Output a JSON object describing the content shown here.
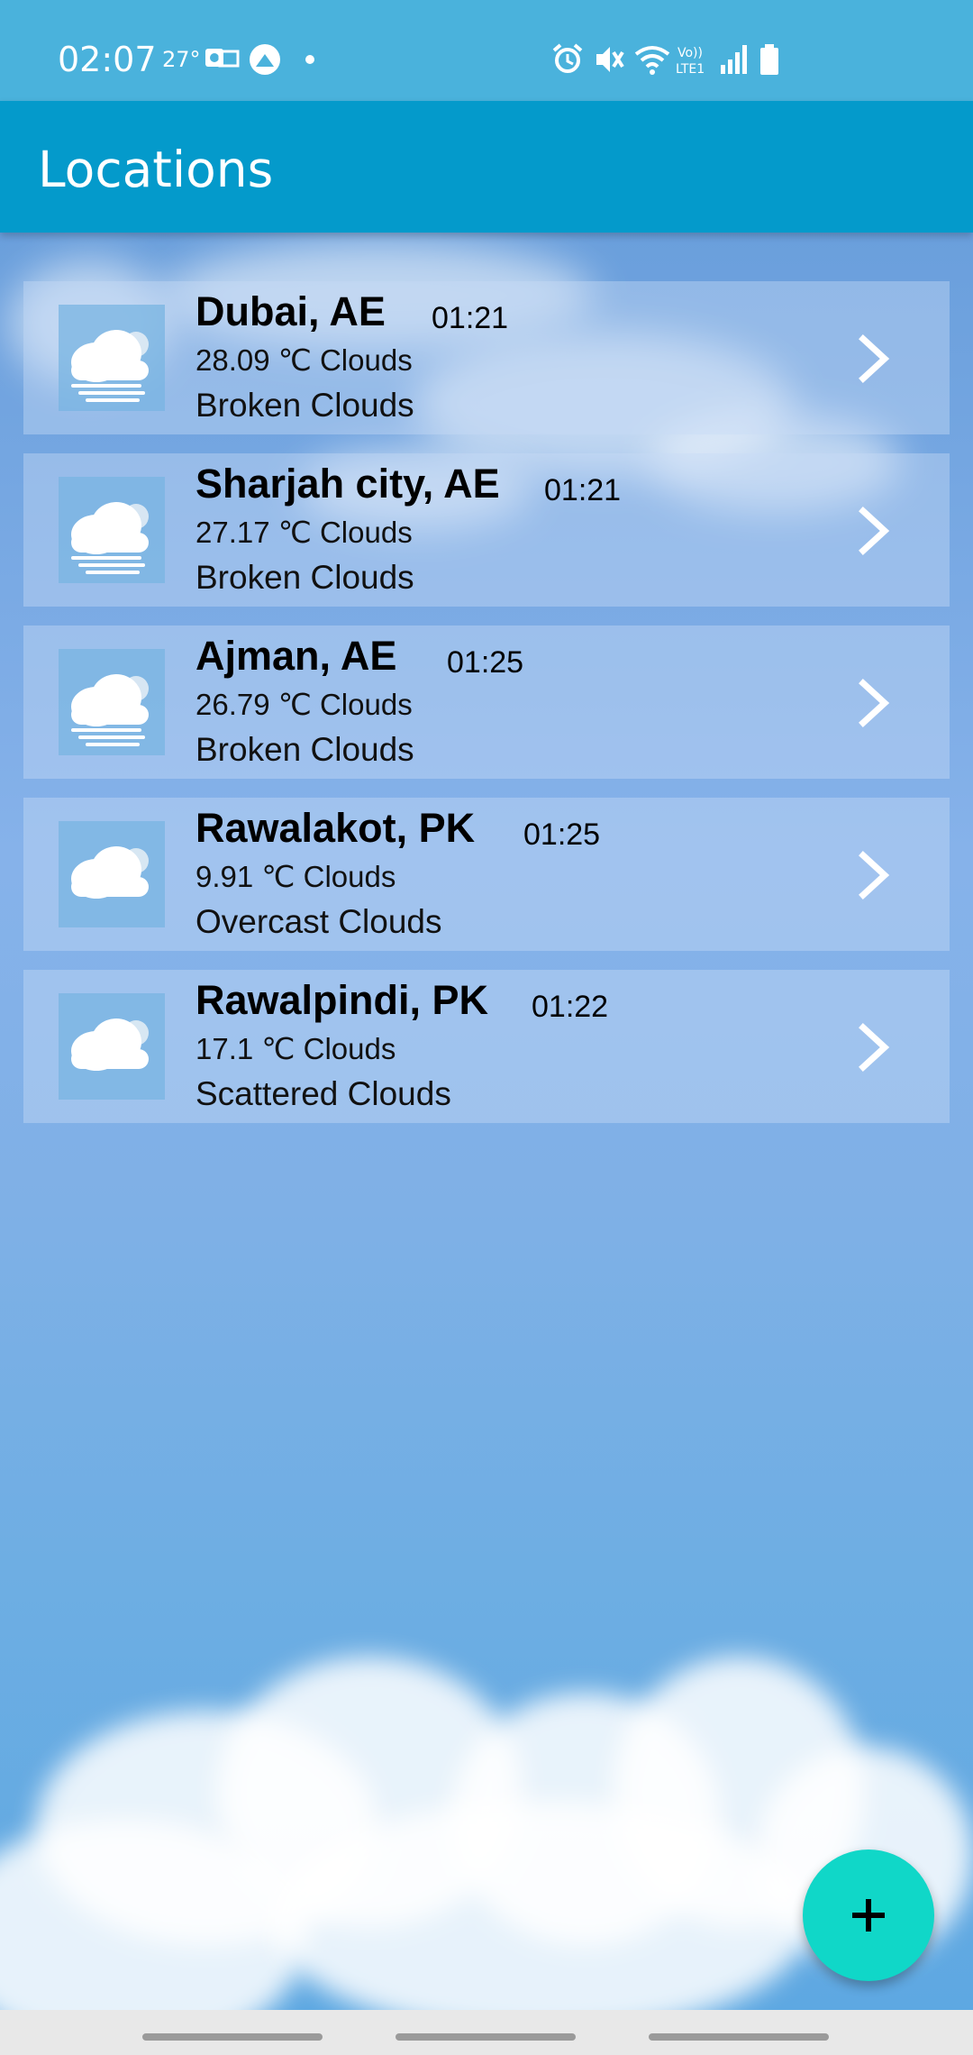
{
  "status_bar": {
    "time": "02:07",
    "temperature": "27°",
    "left_icons": [
      "outlook-icon",
      "app-icon",
      "dot-icon"
    ],
    "right_icons": [
      "alarm-icon",
      "mute-icon",
      "wifi-icon",
      "volte-icon",
      "signal-icon",
      "battery-icon"
    ],
    "volte_label": "Vo)) LTE1"
  },
  "app_bar": {
    "title": "Locations"
  },
  "locations": [
    {
      "city": "Dubai, AE",
      "time": "01:21",
      "temp": "28.09 ℃ Clouds",
      "desc": "Broken Clouds",
      "icon": "broken-clouds-icon"
    },
    {
      "city": "Sharjah city, AE",
      "time": "01:21",
      "temp": "27.17 ℃ Clouds",
      "desc": "Broken Clouds",
      "icon": "broken-clouds-icon"
    },
    {
      "city": "Ajman, AE",
      "time": "01:25",
      "temp": "26.79 ℃ Clouds",
      "desc": "Broken Clouds",
      "icon": "broken-clouds-icon"
    },
    {
      "city": "Rawalakot, PK",
      "time": "01:25",
      "temp": "9.91 ℃ Clouds",
      "desc": "Overcast Clouds",
      "icon": "overcast-clouds-icon"
    },
    {
      "city": "Rawalpindi, PK",
      "time": "01:22",
      "temp": "17.1 ℃ Clouds",
      "desc": "Scattered Clouds",
      "icon": "scattered-clouds-icon"
    }
  ],
  "fab": {
    "icon": "plus-icon",
    "label": "+"
  },
  "colors": {
    "status_bar": "#4ab2dc",
    "app_bar": "#049acb",
    "fab": "#10d7c8"
  }
}
